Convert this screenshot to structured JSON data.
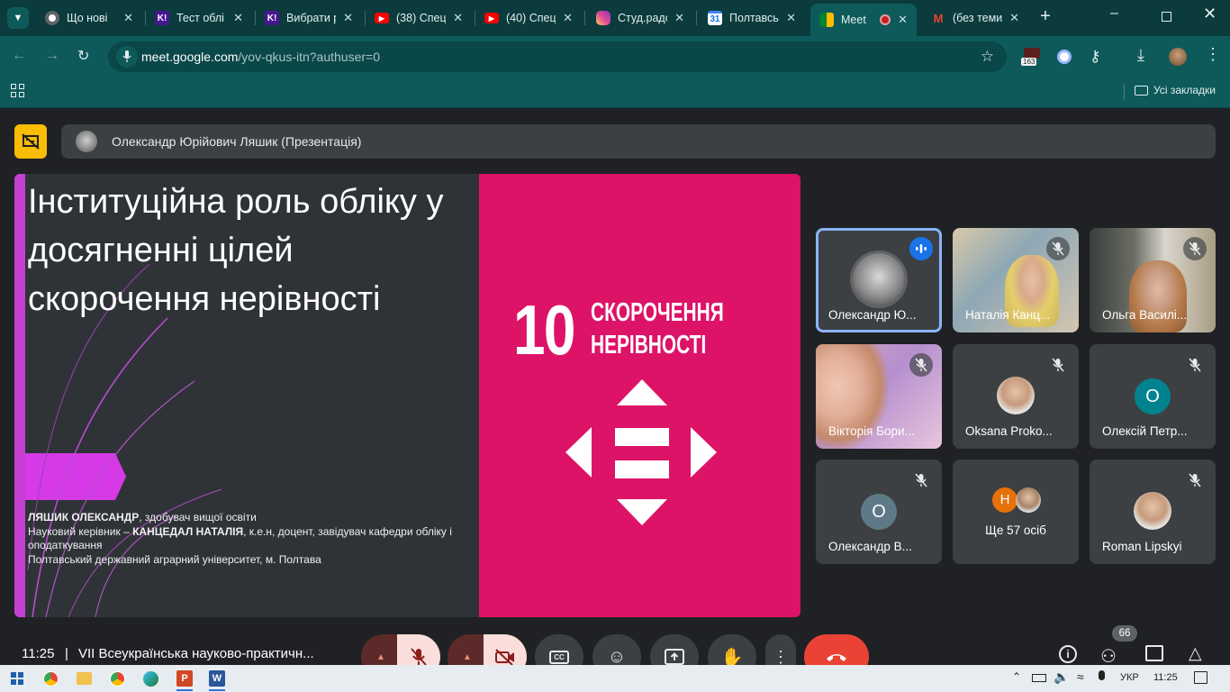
{
  "browser": {
    "tabs": [
      {
        "label": "Що нові",
        "icon": "chrome-icon",
        "color": "#5f6368"
      },
      {
        "label": "Тест облі",
        "icon": "kahoot-icon",
        "color": "#46178f"
      },
      {
        "label": "Вибрати р",
        "icon": "kahoot-icon",
        "color": "#46178f"
      },
      {
        "label": "(38) Спец",
        "icon": "youtube-icon",
        "color": "#ff0000"
      },
      {
        "label": "(40) Спец",
        "icon": "youtube-icon",
        "color": "#ff0000"
      },
      {
        "label": "Студ.радс",
        "icon": "instagram-icon",
        "color": "#d6249f"
      },
      {
        "label": "Полтавсь",
        "icon": "calendar-icon",
        "color": "#4285f4"
      },
      {
        "label": "Meet",
        "icon": "meet-icon",
        "color": "#00832d"
      },
      {
        "label": "(без теми",
        "icon": "gmail-icon",
        "color": "#ea4335"
      }
    ],
    "calendar_badge": "31",
    "url_host": "meet.google.com",
    "url_path": "/yov-qkus-itn?authuser=0",
    "extension_badge": "163",
    "bookmarks_label": "Усі закладки"
  },
  "meet": {
    "presenter_label": "Олександр Юрійович Ляшик (Презентація)",
    "slide": {
      "title": "Інституційна роль обліку у досягненні цілей скорочення нерівності",
      "author_bold": "ЛЯШИК ОЛЕКСАНДР",
      "author_rest": ", здобувач вищої освіти",
      "supervisor_prefix": "Науковий керівник – ",
      "supervisor_bold": "КАНЦЕДАЛ НАТАЛІЯ",
      "supervisor_rest": ", к.е.н, доцент, завідувач кафедри обліку і оподаткування",
      "university": "Полтавський державний аграрний університет, м. Полтава",
      "sdg_number": "10",
      "sdg_line1": "СКОРОЧЕННЯ",
      "sdg_line2": "НЕРІВНОСТІ",
      "sdg_color": "#dd1367"
    },
    "participants": [
      {
        "name": "Олександр Ю...",
        "speaking": true
      },
      {
        "name": "Наталія Канц...",
        "muted": true
      },
      {
        "name": "Ольга Василі...",
        "muted": true
      },
      {
        "name": "Вікторія Бори...",
        "muted": true
      },
      {
        "name": "Oksana Proko...",
        "muted": true
      },
      {
        "name": "Олексій Петр...",
        "muted": true,
        "initial": "О",
        "color": "#00838f"
      },
      {
        "name": "Олександр В...",
        "muted": true,
        "initial": "О",
        "color": "#5f7a87"
      },
      {
        "name": "Ще 57 осіб",
        "initial": "Н",
        "color": "#e8710a"
      },
      {
        "name": "Roman Lipskyi",
        "muted": true
      }
    ],
    "time": "11:25",
    "meeting_title": "VII Всеукраїнська науково-практичн...",
    "people_count": "66",
    "accent_red": "#ea4335",
    "leave_color": "#ea4335"
  },
  "taskbar": {
    "lang": "УКР",
    "clock": "11:25"
  }
}
